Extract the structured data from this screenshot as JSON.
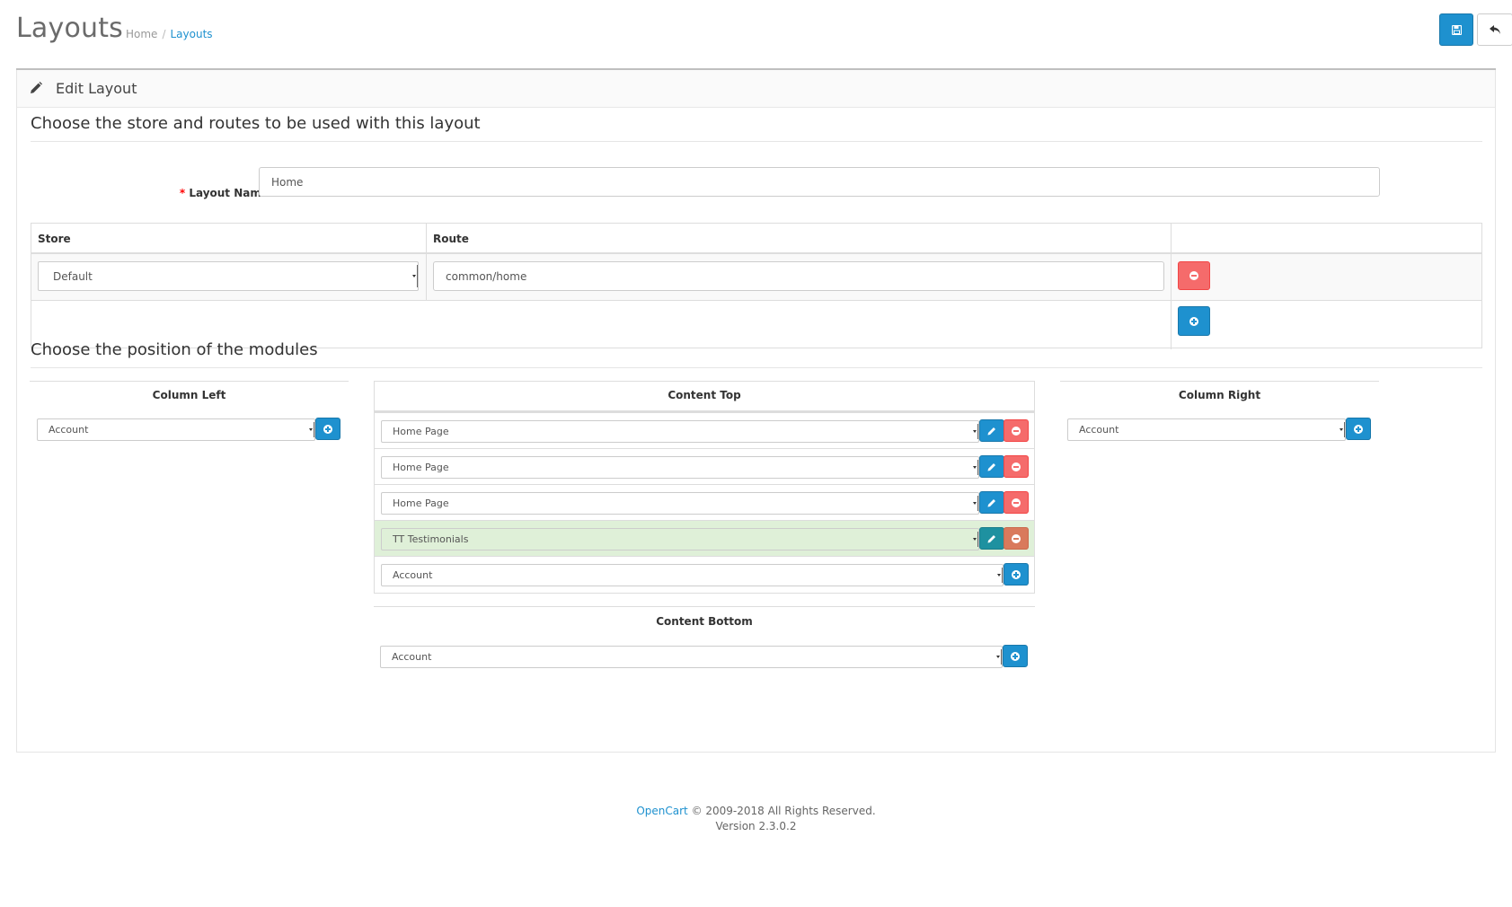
{
  "header": {
    "title": "Layouts",
    "breadcrumb": [
      {
        "label": "Home"
      },
      {
        "label": "Layouts"
      }
    ],
    "save_tooltip": "Save",
    "back_tooltip": "Cancel"
  },
  "panel": {
    "title": "Edit Layout",
    "section_routes": "Choose the store and routes to be used with this layout",
    "layout_name_label": "Layout Name",
    "layout_name_value": "Home",
    "route_table": {
      "col_store": "Store",
      "col_route": "Route",
      "rows": [
        {
          "store": "Default",
          "route": "common/home"
        }
      ]
    },
    "section_modules": "Choose the position of the modules",
    "column_left": {
      "title": "Column Left",
      "add_select": "Account"
    },
    "content_top": {
      "title": "Content Top",
      "modules": [
        {
          "value": "Home Page",
          "highlighted": false
        },
        {
          "value": "Home Page",
          "highlighted": false
        },
        {
          "value": "Home Page",
          "highlighted": false
        },
        {
          "value": "TT Testimonials",
          "highlighted": true
        }
      ],
      "add_select": "Account"
    },
    "column_right": {
      "title": "Column Right",
      "add_select": "Account"
    },
    "content_bottom": {
      "title": "Content Bottom",
      "add_select": "Account"
    }
  },
  "footer": {
    "brand": "OpenCart",
    "copyright": " © 2009-2018 All Rights Reserved.",
    "version": "Version 2.3.0.2"
  },
  "colors": {
    "primary": "#1e91cf",
    "danger": "#f56b6b",
    "success_bg": "#dff0d8"
  }
}
